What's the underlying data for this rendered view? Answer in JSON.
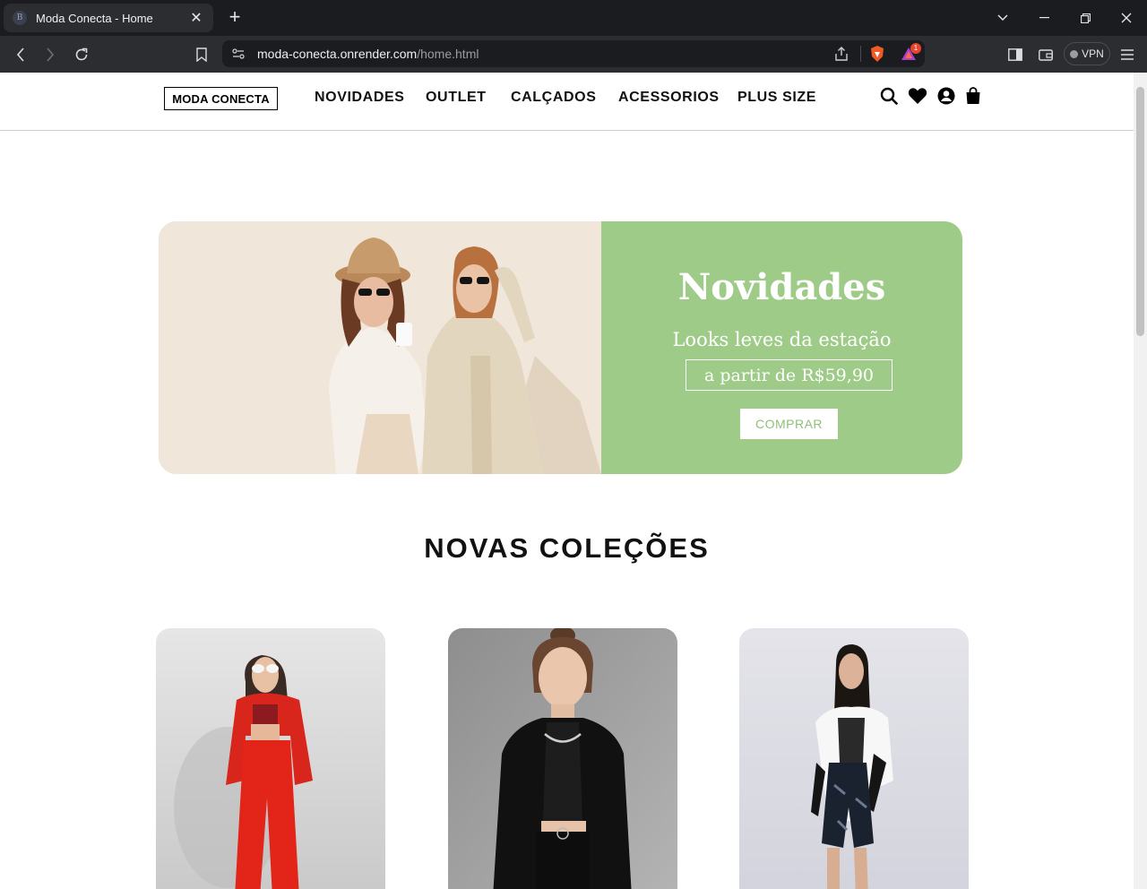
{
  "browser": {
    "tab_title": "Moda Conecta - Home",
    "tab_favicon": "B",
    "url_host": "moda-conecta.onrender.com",
    "url_path": "/home.html",
    "vpn_label": "VPN",
    "notification_count": "1"
  },
  "header": {
    "logo": "MODA CONECTA",
    "nav": [
      "NOVIDADES",
      "OUTLET",
      "CALÇADOS",
      "ACESSORIOS",
      "PLUS SIZE"
    ],
    "icons": [
      "search-icon",
      "heart-icon",
      "user-icon",
      "shopping-bag-icon"
    ]
  },
  "hero": {
    "title": "Novidades",
    "subtitle": "Looks leves da estação",
    "price": "a partir de R$59,90",
    "button": "COMPRAR",
    "accent_color": "#9fcb88"
  },
  "collections": {
    "title": "NOVAS COLEÇÕES",
    "cards": [
      "red-suit-model-photo",
      "black-outfit-model-photo",
      "white-shirt-model-photo"
    ]
  }
}
